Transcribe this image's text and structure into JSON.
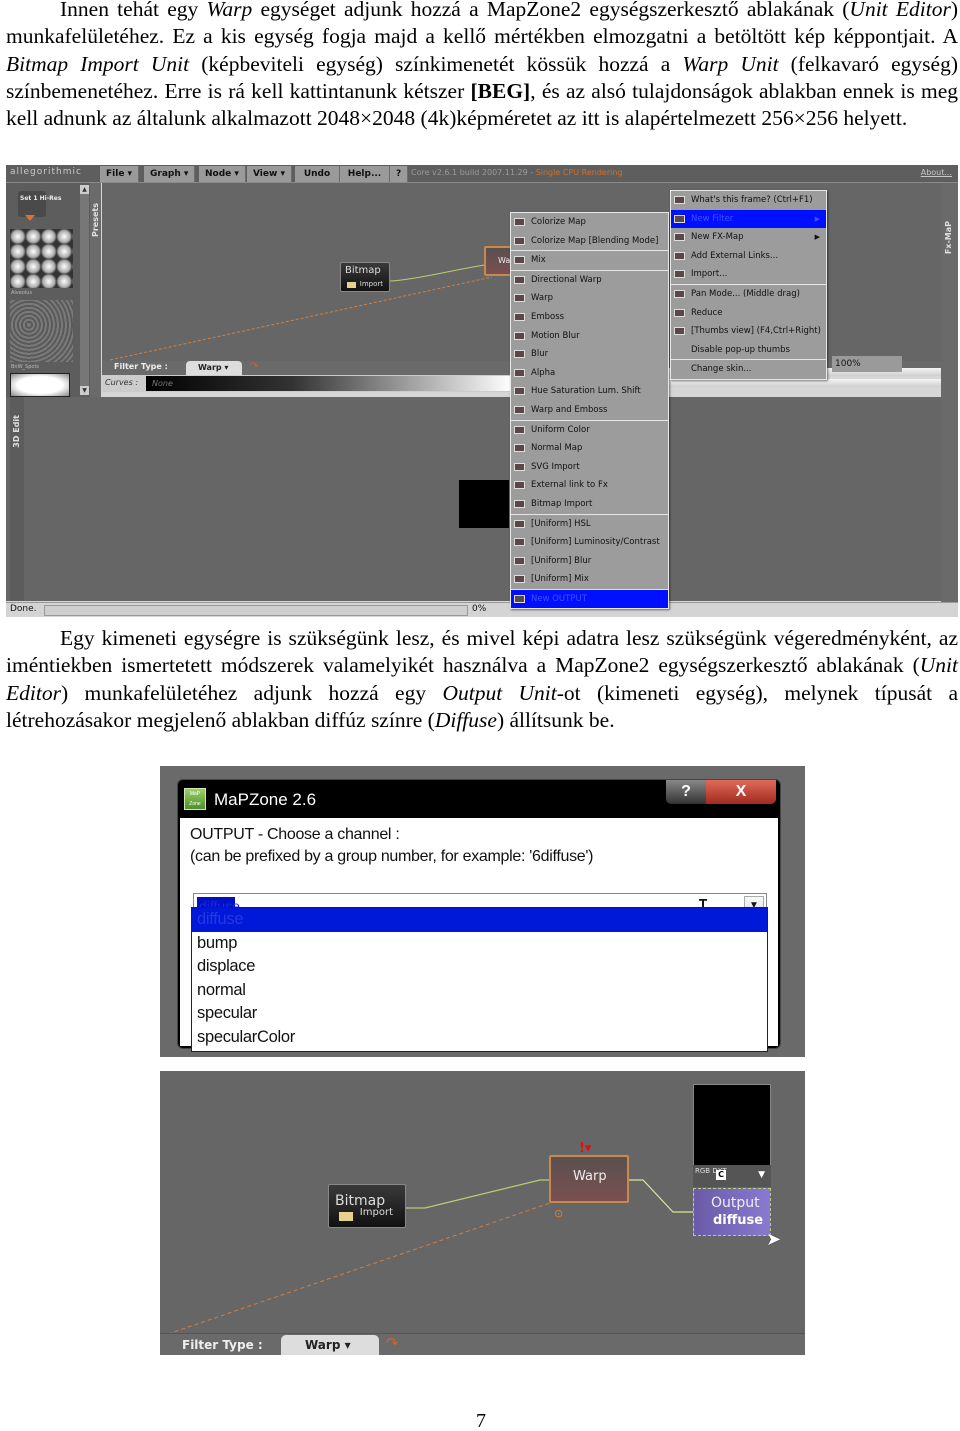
{
  "paragraph1": {
    "s1": "Innen tehát egy ",
    "s2": "Warp",
    "s3": " egységet adjunk hozzá a MapZone2 egységszerkesztő ablakának (",
    "s4": "Unit Editor",
    "s5": ") munkafelületéhez. Ez a kis egység fogja majd a kellő mértékben elmozgatni a betöltött kép képpontjait. A ",
    "s6": "Bitmap Import Unit",
    "s7": " (képbeviteli egység) színkimenetét kössük hozzá a ",
    "s8": "Warp Unit",
    "s9": " (felkavaró egység) színbemenetéhez. Erre is rá kell kattintanunk kétszer ",
    "s10": "[BEG]",
    "s11": ", és az alsó tulajdonságok ablakban ennek is meg kell adnunk az általunk alkalmazott 2048×2048 (4k)képméretet az itt is alapértelmezett 256×256 helyett."
  },
  "paragraph2": {
    "s1": "Egy kimeneti egységre is szükségünk lesz, és mivel képi adatra lesz szükségünk végeredményként, az iméntiekben ismertetett módszerek valamelyikét használva a MapZone2 egységszerkesztő ablakának (",
    "s2": "Unit Editor",
    "s3": ") munkafelületéhez adjunk hozzá egy ",
    "s4": "Output Unit",
    "s5": "-ot (kimeneti egység), melynek típusát a létrehozásakor megjelenő ablakban diffúz színre (",
    "s6": "Diffuse",
    "s7": ") állítsunk be."
  },
  "screenshot1": {
    "logo": "allegorithmic",
    "menus": [
      "File ▾",
      "Graph ▾",
      "Node ▾",
      "View ▾",
      "Undo",
      "Help...",
      "?"
    ],
    "version": "Core v2.6.1 build 2007.11.29 - ",
    "rendering": "Single CPU Rendering",
    "about": "About...",
    "presets_tab": "Presets",
    "preset_set": "Set 1 Hi-Res",
    "preset_labels": [
      "Alveolus",
      "BnW_Spots"
    ],
    "bitmap_node": {
      "title": "Bitmap",
      "subtitle": "Import"
    },
    "warp_node": {
      "title": "Warp"
    },
    "filter_type_label": "Filter Type :",
    "filter_type_value": "Warp ▾",
    "curves_label": "Curves :",
    "curves_value": "None",
    "edit3d_tab": "3D Edit",
    "fxmap_tab": "Fx-MaP",
    "zoom_value": "100%",
    "status": "Done.",
    "progress_text": "0%",
    "progress": 0,
    "context_menu_left": [
      {
        "label": "Colorize Map",
        "icon": "colorize-icon"
      },
      {
        "label": "Colorize Map [Blending Mode]",
        "icon": "colorize-blend-icon"
      },
      {
        "sep": true
      },
      {
        "label": "Mix",
        "icon": "mix-icon"
      },
      {
        "sep": true
      },
      {
        "label": "Directional Warp",
        "icon": "directional-warp-icon"
      },
      {
        "label": "Warp",
        "icon": "warp-icon"
      },
      {
        "label": "Emboss",
        "icon": "emboss-icon"
      },
      {
        "label": "Motion Blur",
        "icon": "motion-blur-icon"
      },
      {
        "label": "Blur",
        "icon": "blur-icon"
      },
      {
        "label": "Alpha",
        "icon": "alpha-icon"
      },
      {
        "label": "Hue Saturation Lum. Shift",
        "icon": "hsl-icon"
      },
      {
        "label": "Warp and Emboss",
        "icon": "warp-emboss-icon"
      },
      {
        "sep": true
      },
      {
        "label": "Uniform Color",
        "icon": "uniform-color-icon"
      },
      {
        "label": "Normal Map",
        "icon": "normal-map-icon"
      },
      {
        "label": "SVG Import",
        "icon": "svg-import-icon"
      },
      {
        "label": "External link to Fx",
        "icon": "external-link-icon"
      },
      {
        "label": "Bitmap Import",
        "icon": "bitmap-import-icon"
      },
      {
        "sep": true
      },
      {
        "label": "[Uniform] HSL",
        "icon": "uniform-hsl-icon"
      },
      {
        "label": "[Uniform] Luminosity/Contrast",
        "icon": "uniform-lum-icon"
      },
      {
        "label": "[Uniform] Blur",
        "icon": "uniform-blur-icon"
      },
      {
        "label": "[Uniform] Mix",
        "icon": "uniform-mix-icon"
      },
      {
        "sep": true
      },
      {
        "label": "New OUTPUT",
        "icon": "output-icon",
        "selected": true
      }
    ],
    "context_menu_right": [
      {
        "label": "What's this frame? (Ctrl+F1)",
        "icon": "help-icon"
      },
      {
        "label": "New Filter",
        "icon": "new-filter-icon",
        "submenu": true,
        "selected": true
      },
      {
        "label": "New FX-Map",
        "icon": "new-fxmap-icon",
        "submenu": true
      },
      {
        "label": "Add External Links...",
        "icon": "external-links-icon"
      },
      {
        "label": "Import...",
        "icon": "import-icon"
      },
      {
        "sep": true
      },
      {
        "label": "Pan Mode... (Middle drag)",
        "icon": "pan-icon"
      },
      {
        "label": "Reduce",
        "icon": "reduce-icon"
      },
      {
        "label": "[Thumbs view] (F4,Ctrl+Right)",
        "icon": "thumbs-icon"
      },
      {
        "label": "Disable pop-up thumbs",
        "icon": ""
      },
      {
        "sep": true
      },
      {
        "label": "Change skin...",
        "icon": ""
      }
    ]
  },
  "screenshot2": {
    "window_title": "MaPZone 2.6",
    "app_icon_text": "MaP Zone",
    "help_button": "?",
    "close_button": "X",
    "prompt_line1": "OUTPUT - Choose a channel :",
    "prompt_line2": "(can be prefixed by a group number, for example: '6diffuse')",
    "combo_value": "diffuse",
    "options": [
      "diffuse",
      "bump",
      "displace",
      "normal",
      "specular",
      "specularColor"
    ],
    "selected_option": "diffuse"
  },
  "screenshot3": {
    "bitmap_node": {
      "title": "Bitmap",
      "subtitle": "Import"
    },
    "warp_node": {
      "title": "Warp",
      "alert": "!▾"
    },
    "output_format": "RGB DXT",
    "output_format_btn": "C",
    "output_node": {
      "title": "Output",
      "subtitle": "diffuse"
    },
    "filter_type_label": "Filter Type :",
    "filter_type_value": "Warp ▾"
  },
  "page_number": "7"
}
